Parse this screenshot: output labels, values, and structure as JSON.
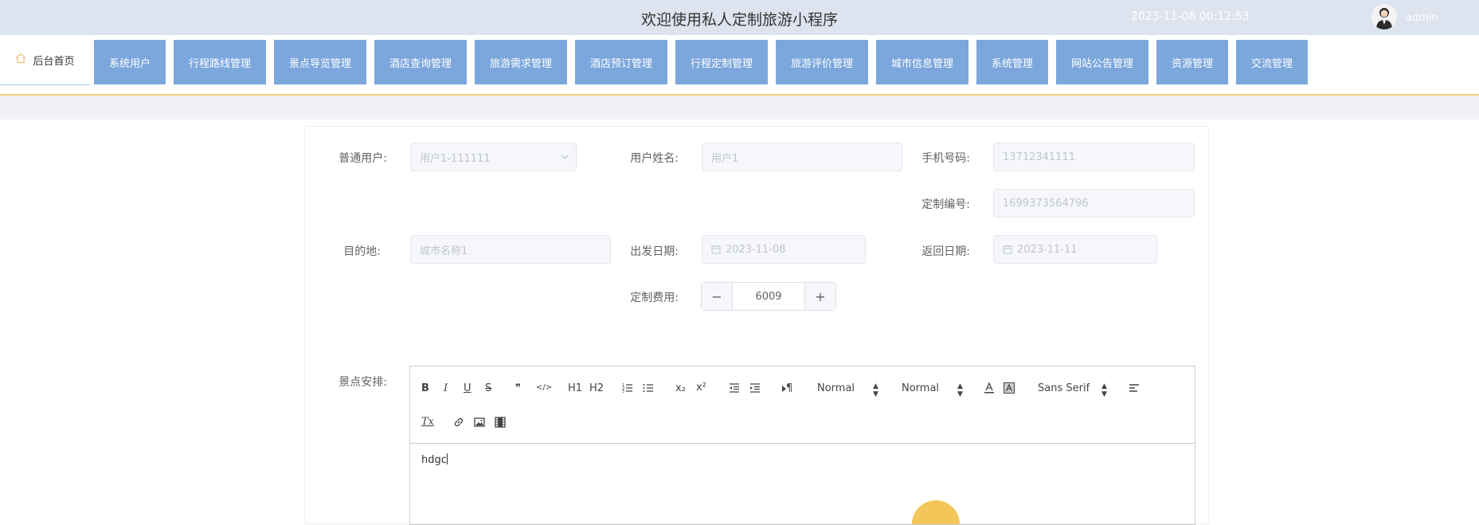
{
  "header": {
    "title": "欢迎使用私人定制旅游小程序",
    "datetime": "2023-11-08 00:12:53",
    "username": "admin"
  },
  "nav": {
    "home": "后台首页",
    "items": [
      {
        "label": "系统用户"
      },
      {
        "label": "行程路线管理"
      },
      {
        "label": "景点导览管理"
      },
      {
        "label": "酒店查询管理"
      },
      {
        "label": "旅游需求管理"
      },
      {
        "label": "酒店预订管理"
      },
      {
        "label": "行程定制管理"
      },
      {
        "label": "旅游评价管理"
      },
      {
        "label": "城市信息管理"
      },
      {
        "label": "系统管理"
      },
      {
        "label": "网站公告管理"
      },
      {
        "label": "资源管理"
      },
      {
        "label": "交流管理"
      }
    ]
  },
  "form": {
    "user": {
      "label": "普通用户:",
      "value": "用户1-111111"
    },
    "name": {
      "label": "用户姓名:",
      "value": "用户1"
    },
    "phone": {
      "label": "手机号码:",
      "value": "13712341111"
    },
    "code": {
      "label": "定制编号:",
      "value": "1699373564796"
    },
    "destination": {
      "label": "目的地:",
      "value": "城市名称1"
    },
    "depart": {
      "label": "出发日期:",
      "value": "2023-11-08"
    },
    "return": {
      "label": "返回日期:",
      "value": "2023-11-11"
    },
    "cost": {
      "label": "定制费用:",
      "value": "6009",
      "minus": "−",
      "plus": "+"
    },
    "schedule": {
      "label": "景点安排:",
      "content": "hdgc"
    }
  },
  "editor": {
    "bold": "B",
    "italic": "I",
    "underline": "U",
    "strike": "S",
    "quote": "❞",
    "code": "</>",
    "h1": "H1",
    "h2": "H2",
    "sub": "x₂",
    "sup": "x²",
    "direction": "¶",
    "header_picker": "Normal",
    "size_picker": "Normal",
    "font_picker": "Sans Serif",
    "clean": "Tx"
  },
  "colors": {
    "topbar": "#dde4ef",
    "nav_button": "#7ca7dc",
    "nav_underline": "#f3d27a"
  }
}
